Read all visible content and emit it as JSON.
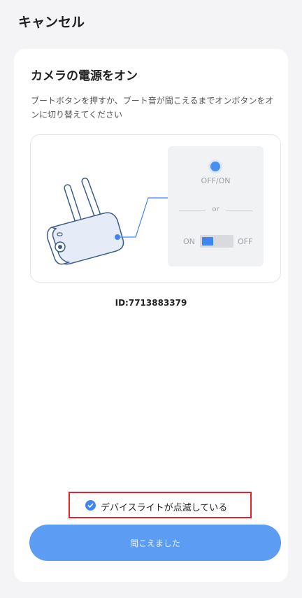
{
  "header": {
    "cancel_label": "キャンセル"
  },
  "card": {
    "title": "カメラの電源をオン",
    "description": "ブートボタンを押すか、ブート音が聞こえるまでオンボタンをオンに切り替えてください",
    "illustration": {
      "offon_label": "OFF/ON",
      "or_label": "or",
      "on_label": "ON",
      "off_label": "OFF",
      "switch_state": "on",
      "accent_color": "#3f86f0"
    },
    "device_id": "ID:7713883379",
    "confirm_checkbox": {
      "label": "デバイスライトが点滅している",
      "checked": true,
      "highlight_color": "#e5212a"
    },
    "primary_button": {
      "label": "聞こえました",
      "color": "#5c9cf2"
    }
  }
}
